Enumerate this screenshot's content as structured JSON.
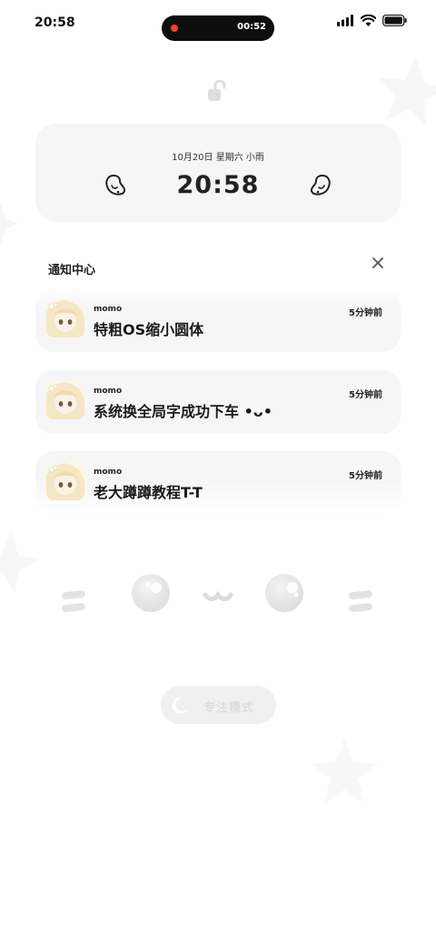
{
  "status_bar": {
    "time": "20:58",
    "recording_time": "00:52"
  },
  "lock_screen": {
    "date_line": "10月20日 星期六 小雨",
    "clock": "20:58"
  },
  "notification_center": {
    "title": "通知中心",
    "notifications": [
      {
        "app": "momo",
        "message": "特粗OS缩小圆体",
        "time": "5分钟前"
      },
      {
        "app": "momo",
        "message": "系统换全局字成功下车 •ᴗ•",
        "time": "5分钟前"
      },
      {
        "app": "momo",
        "message": "老大蹲蹲教程T-T",
        "time": "5分钟前"
      }
    ]
  },
  "focus_mode": {
    "label": "专注模式"
  },
  "icons": {
    "status": [
      "signal-icon",
      "wifi-icon",
      "battery-icon"
    ],
    "lock": "unlocked-padlock-icon",
    "close": "close-icon",
    "focus": "moon-icon"
  },
  "colors": {
    "recording": "#ff3b30",
    "card": "#f6f6f6"
  }
}
